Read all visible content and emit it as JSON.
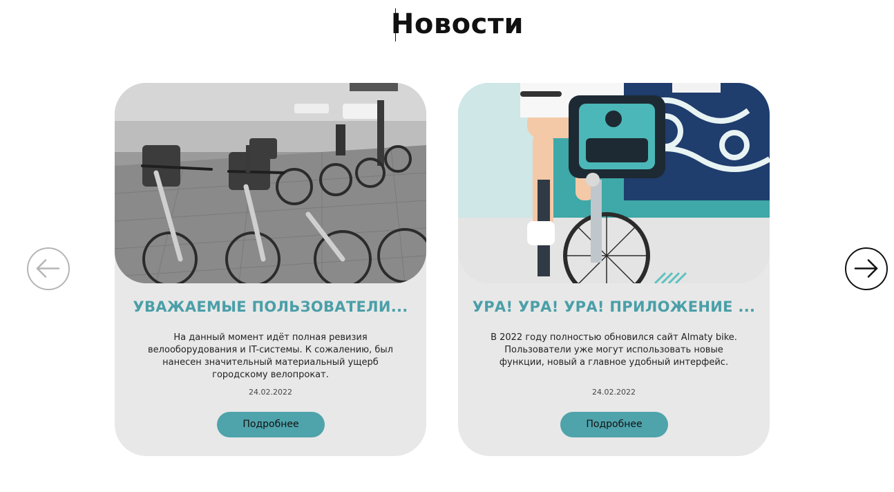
{
  "section": {
    "title": "Новости"
  },
  "navigation": {
    "prev_icon": "arrow-left-icon",
    "next_icon": "arrow-right-icon"
  },
  "colors": {
    "accent": "#4fa3ab",
    "title_teal": "#4a9fa8",
    "card_bg": "#e8e8e8"
  },
  "cards": [
    {
      "title": "УВАЖАЕМЫЕ ПОЛЬЗОВАТЕЛИ...",
      "text": "На данный момент идёт полная ревизия велооборудования и IT-системы. К сожалению, был нанесен значительный материальный ущерб городскому велопрокат.",
      "date": "24.02.2022",
      "button_label": "Подробнее",
      "image": "bike-station-photo"
    },
    {
      "title": "УРА! УРА! УРА! ПРИЛОЖЕНИЕ ...",
      "text": "В 2022 году полностью обновился сайт Almaty bike. Пользователи уже могут использовать новые функции, новый а главное удобный интерфейс.",
      "date": "24.02.2022",
      "button_label": "Подробнее",
      "image": "cyclist-photo"
    }
  ]
}
